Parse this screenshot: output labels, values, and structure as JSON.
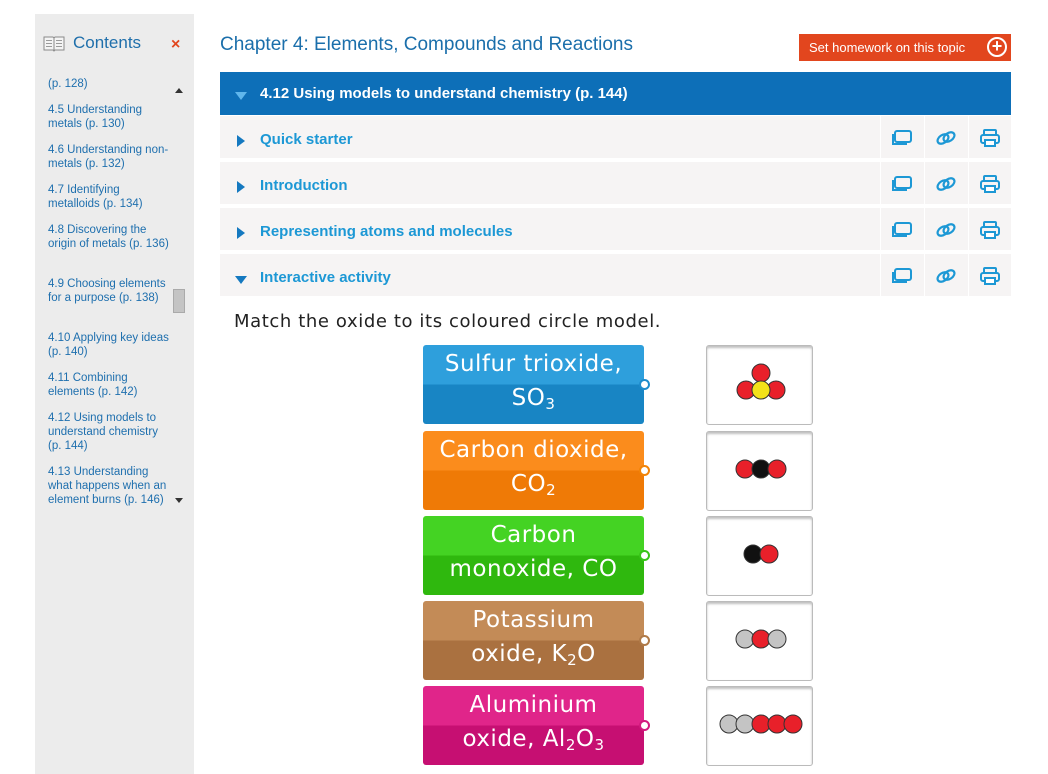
{
  "sidebar": {
    "title": "Contents",
    "close_label": "×",
    "items": [
      {
        "label": "(p. 128)"
      },
      {
        "label": "4.5 Understanding metals (p. 130)"
      },
      {
        "label": "4.6 Understanding non-metals (p. 132)"
      },
      {
        "label": "4.7 Identifying metalloids (p. 134)"
      },
      {
        "label": "4.8 Discovering the origin of metals (p. 136)"
      },
      {
        "label": "4.9 Choosing elements for a purpose (p. 138)"
      },
      {
        "label": "4.10 Applying key ideas (p. 140)"
      },
      {
        "label": "4.11 Combining elements (p. 142)"
      },
      {
        "label": "4.12 Using models to understand chemistry (p. 144)"
      },
      {
        "label": "4.13 Understanding what happens when an element burns (p. 146)"
      }
    ]
  },
  "header": {
    "chapter_title": "Chapter 4: Elements, Compounds and Reactions",
    "homework_button": "Set homework on this topic",
    "homework_plus": "+"
  },
  "section": {
    "title": "4.12 Using models to understand chemistry (p. 144)"
  },
  "rows": [
    {
      "label": "Quick starter",
      "expanded": false
    },
    {
      "label": "Introduction",
      "expanded": false
    },
    {
      "label": "Representing atoms and molecules",
      "expanded": false
    },
    {
      "label": "Interactive activity",
      "expanded": true
    }
  ],
  "activity": {
    "prompt": "Match the oxide to its coloured circle model.",
    "tiles": [
      {
        "line1": "Sulfur trioxide,",
        "line2_pre": "SO",
        "line2_sub": "3",
        "line2_post": "",
        "color_top": "#2e9fdc",
        "color_bottom": "#1885c4",
        "dot_color": "#1e8ccc"
      },
      {
        "line1": "Carbon dioxide,",
        "line2_pre": "CO",
        "line2_sub": "2",
        "line2_post": "",
        "color_top": "#fb8c1c",
        "color_bottom": "#ef7a06",
        "dot_color": "#f28407"
      },
      {
        "line1": "Carbon",
        "line2_pre": "monoxide, CO",
        "line2_sub": "",
        "line2_post": "",
        "color_top": "#44d323",
        "color_bottom": "#2fb80e",
        "dot_color": "#38c418"
      },
      {
        "line1": "Potassium",
        "line2_pre": "oxide, K",
        "line2_sub": "2",
        "line2_post": "O",
        "color_top": "#c38b57",
        "color_bottom": "#aa7140",
        "dot_color": "#b07a48"
      },
      {
        "line1": "Aluminium",
        "line2_pre": "oxide, Al",
        "line2_sub": "2",
        "line2_post": "O",
        "line2_sub2": "3",
        "color_top": "#e0258a",
        "color_bottom": "#c60f72",
        "dot_color": "#d2197e"
      }
    ],
    "models": [
      {
        "name": "model-so3",
        "atoms": [
          "O",
          "O",
          "S",
          "O"
        ]
      },
      {
        "name": "model-co2",
        "atoms": [
          "O",
          "C",
          "O"
        ]
      },
      {
        "name": "model-co",
        "atoms": [
          "C",
          "O"
        ]
      },
      {
        "name": "model-k2o",
        "atoms": [
          "K",
          "O",
          "K"
        ]
      },
      {
        "name": "model-al2o3",
        "atoms": [
          "Al",
          "Al",
          "O",
          "O",
          "O"
        ]
      }
    ],
    "atom_colors": {
      "O": "#e8202a",
      "S": "#f3e21a",
      "C": "#111111",
      "K": "#c4c4c4",
      "Al": "#c4c4c4"
    }
  }
}
